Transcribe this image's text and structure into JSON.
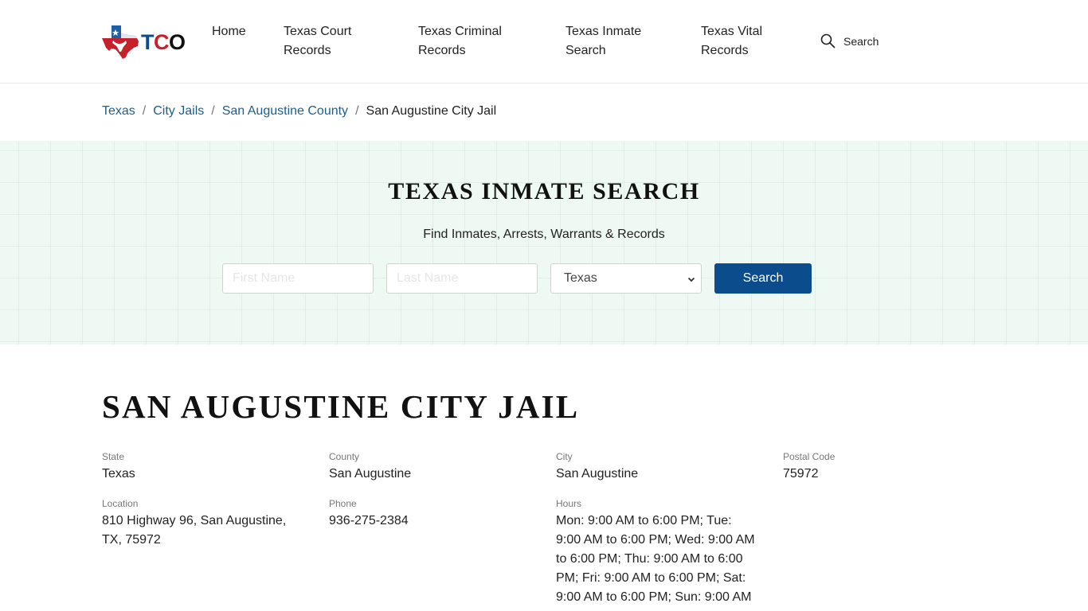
{
  "header": {
    "logo_text": [
      "T",
      "C",
      "O"
    ],
    "nav": [
      {
        "label": "Home"
      },
      {
        "label": "Texas Court Records"
      },
      {
        "label": "Texas Criminal Records"
      },
      {
        "label": "Texas Inmate Search"
      },
      {
        "label": "Texas Vital Records"
      }
    ],
    "search_label": "Search",
    "search_icon": "search-icon"
  },
  "breadcrumb": {
    "items": [
      "Texas",
      "City Jails",
      "San Augustine County"
    ],
    "separator": "/",
    "current": "San Augustine City Jail"
  },
  "search_band": {
    "title": "TEXAS INMATE SEARCH",
    "subtitle": "Find Inmates, Arrests, Warrants & Records",
    "first_name_placeholder": "First Name",
    "last_name_placeholder": "Last Name",
    "state_selected": "Texas",
    "button_label": "Search",
    "accent_color": "#0b4d8c"
  },
  "facility": {
    "title": "SAN AUGUSTINE CITY JAIL",
    "fields": [
      {
        "label": "State",
        "value": "Texas"
      },
      {
        "label": "County",
        "value": "San Augustine"
      },
      {
        "label": "City",
        "value": "San Augustine"
      },
      {
        "label": "Postal Code",
        "value": "75972"
      },
      {
        "label": "Location",
        "value": "810 Highway 96, San Augustine, TX, 75972"
      },
      {
        "label": "Phone",
        "value": "936-275-2384"
      },
      {
        "label": "Hours",
        "value": "Mon: 9:00 AM to 6:00 PM; Tue: 9:00 AM to 6:00 PM; Wed: 9:00 AM to 6:00 PM; Thu: 9:00 AM to 6:00 PM; Fri: 9:00 AM to 6:00 PM; Sat: 9:00 AM to 6:00 PM; Sun: 9:00 AM"
      }
    ]
  }
}
